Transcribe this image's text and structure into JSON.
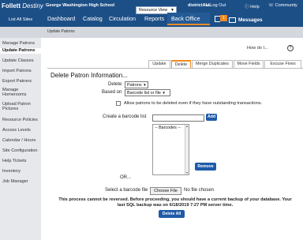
{
  "topbar": {
    "brand_name": "Follett",
    "brand_product": "Destiny",
    "school": "George Washington High School",
    "resource_view": "Resource View",
    "district": "districtALL",
    "logout": "Log Out",
    "help": "Help",
    "community": "Community",
    "list_all_sites": "List All Sites",
    "nav": [
      "Dashboard",
      "Catalog",
      "Circulation",
      "Reports",
      "Back Office"
    ],
    "notification_count": "1",
    "messages": "Messages",
    "accent_color": "#f08a24",
    "bar_color": "#1d4f87"
  },
  "subheader": {
    "title": "Update Patrons"
  },
  "sidebar": {
    "items": [
      "Manage Patrons",
      "Update Patrons",
      "Update Classes",
      "Import Patrons",
      "Export Patrons",
      "Manage",
      "Homerooms",
      "Upload Patron",
      "Pictures",
      "Resource Policies",
      "Access Levels",
      "Calendar / Hours",
      "Site Configuration",
      "Help Tickets",
      "Inventory",
      "Job Manager"
    ]
  },
  "main": {
    "how_do_i": "How do I...",
    "help_icon": "?",
    "tabs": [
      "Update",
      "Delete",
      "Merge Duplicates",
      "Move Fields",
      "Excuse Fines"
    ],
    "active_tab": "Delete",
    "section_title": "Delete Patron Information...",
    "delete_label": "Delete",
    "delete_value": "Patrons",
    "based_on_label": "Based on",
    "based_on_value": "Barcode list or file",
    "allow_checkbox_label": "Allow patrons to be deleted even if they have outstanding transactions.",
    "allow_checked": false,
    "create_barcode_label": "Create a barcode list",
    "add_button": "Add",
    "barcodes_option": "-- Barcodes --",
    "remove_button": "Remove",
    "or_label": "OR...",
    "select_file_label": "Select a barcode file",
    "choose_file_button": "Choose File",
    "no_file": "No file chosen",
    "warning_line1": "This process cannot be reversed. Before proceeding, you should have a current backup of your database. Your",
    "warning_line2": "last SQL backup was on 6/18/2019 7:27 PM server time.",
    "delete_all_button": "Delete All"
  }
}
